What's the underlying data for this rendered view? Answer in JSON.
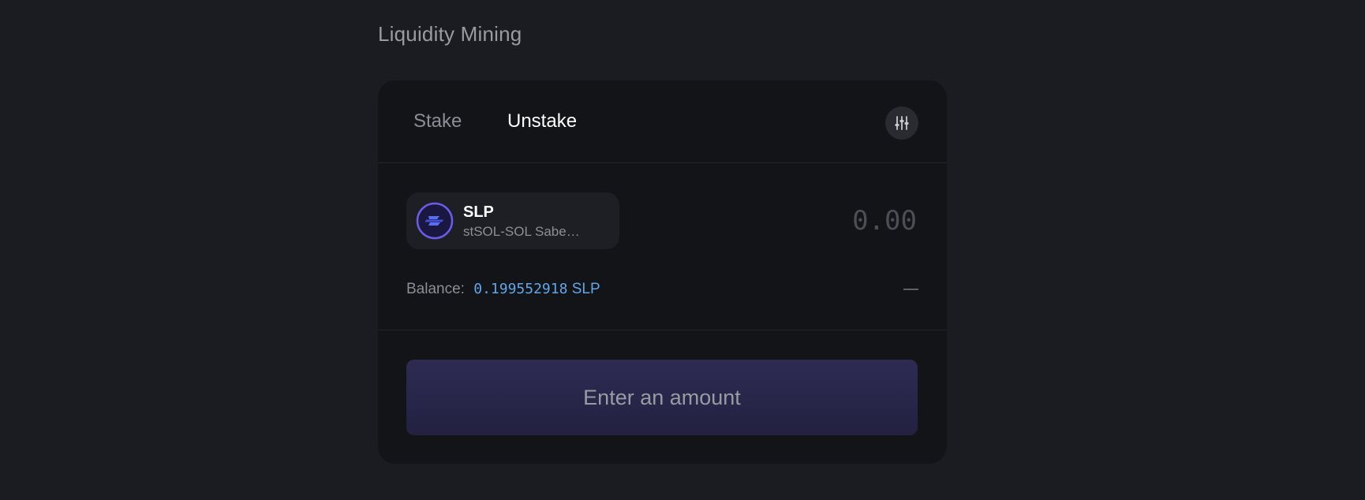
{
  "header": {
    "title": "Liquidity Mining"
  },
  "tabs": [
    {
      "label": "Stake",
      "active": false
    },
    {
      "label": "Unstake",
      "active": true
    }
  ],
  "settings": {
    "icon": "sliders-icon"
  },
  "token": {
    "symbol": "SLP",
    "name": "stSOL-SOL Sabe…",
    "logo_icon": "saber-logo-icon",
    "logo_color": "#6b5ce7"
  },
  "amount": {
    "value": "",
    "placeholder": "0.00"
  },
  "balance": {
    "label": "Balance:",
    "amount": "0.199552918",
    "unit": "SLP"
  },
  "usd_value": "—",
  "submit": {
    "label": "Enter an amount"
  },
  "colors": {
    "background": "#1b1c21",
    "card": "#131418",
    "accent_link": "#5fa7e8",
    "button_bg": "#2a2849"
  }
}
